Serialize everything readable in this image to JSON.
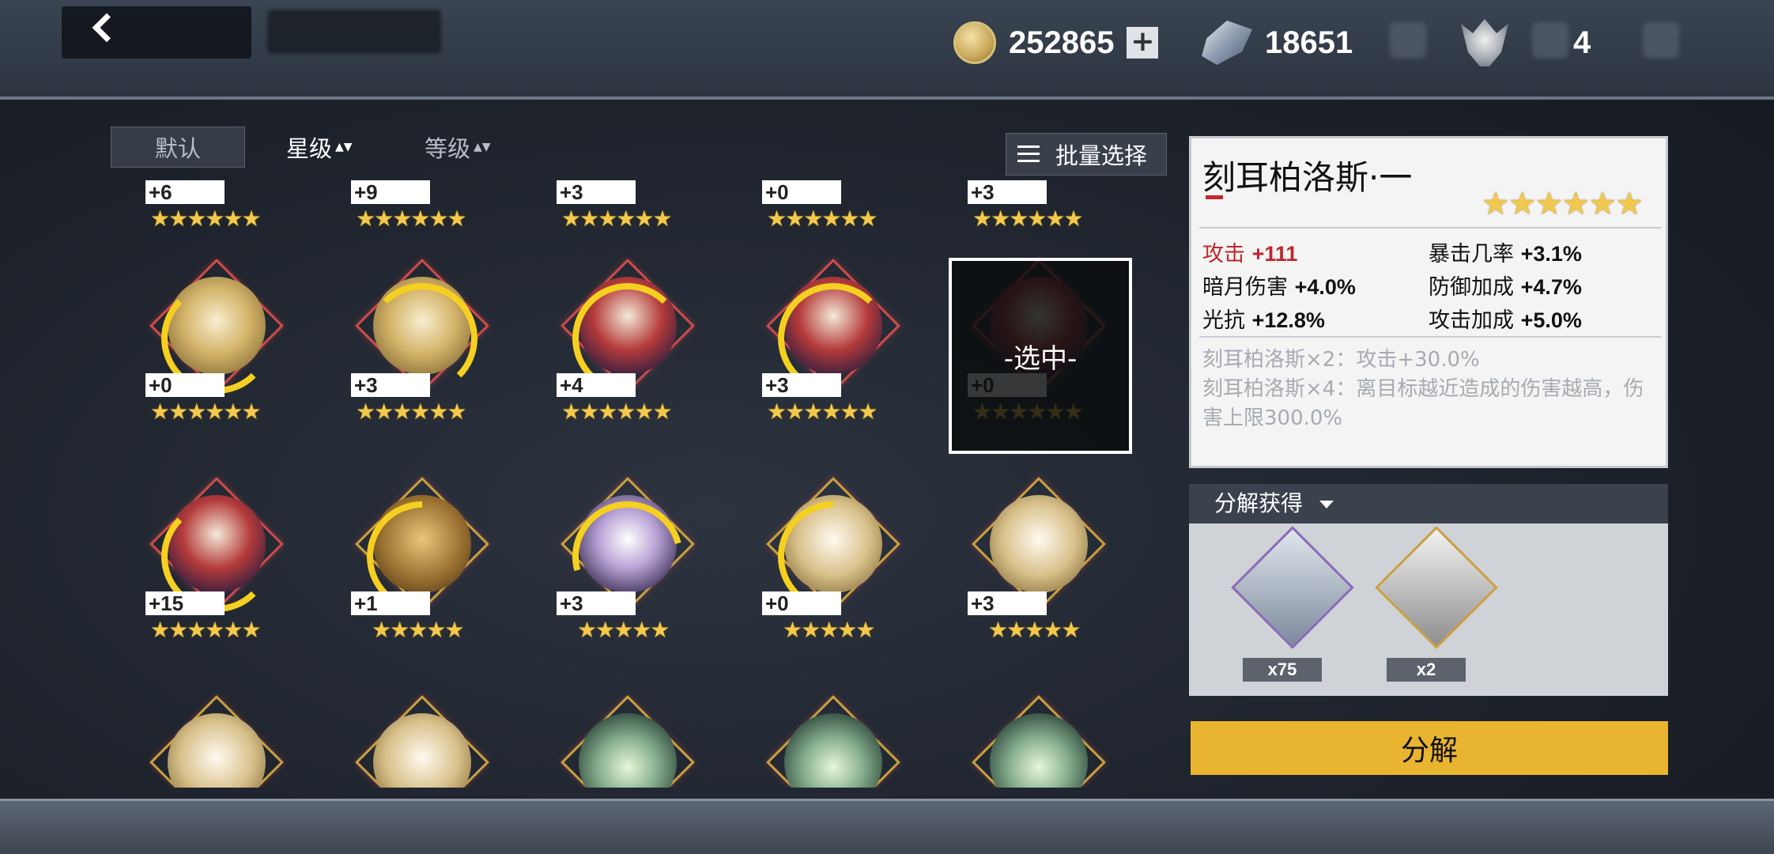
{
  "header": {
    "coins": "252865",
    "crystals": "18651",
    "skulls": "4",
    "add_symbol": "+"
  },
  "sort": {
    "default_label": "默认",
    "star_label": "星级",
    "level_label": "等级",
    "arrows": "▲▼",
    "batch_label": "批量选择"
  },
  "grid": {
    "row0": [
      {
        "plus": "+6",
        "stars": "★★★★★★"
      },
      {
        "plus": "+9",
        "stars": "★★★★★★"
      },
      {
        "plus": "+3",
        "stars": "★★★★★★"
      },
      {
        "plus": "+0",
        "stars": "★★★★★★"
      },
      {
        "plus": "+3",
        "stars": "★★★★★★"
      }
    ],
    "row1": [
      {
        "plus": "+0",
        "stars": "★★★★★★",
        "icon": "sphinx"
      },
      {
        "plus": "+3",
        "stars": "★★★★★★",
        "icon": "sphinx"
      },
      {
        "plus": "+4",
        "stars": "★★★★★★",
        "icon": "cerberus"
      },
      {
        "plus": "+3",
        "stars": "★★★★★★",
        "icon": "cerberus"
      },
      {
        "plus": "+0",
        "stars": "★★★★★★",
        "icon": "cerberus",
        "selected": true
      }
    ],
    "row2": [
      {
        "plus": "+15",
        "stars": "★★★★★★",
        "icon": "cerberus"
      },
      {
        "plus": "+1",
        "stars": "★★★★★",
        "icon": "lion"
      },
      {
        "plus": "+3",
        "stars": "★★★★★",
        "icon": "serpent"
      },
      {
        "plus": "+0",
        "stars": "★★★★★",
        "icon": "phoenix"
      },
      {
        "plus": "+3",
        "stars": "★★★★★",
        "icon": "phoenix"
      }
    ],
    "selected_label": "-选中-"
  },
  "detail": {
    "name": "刻耳柏洛斯·一",
    "stars": "★★★★★★",
    "stats": [
      {
        "label": "攻击",
        "value": "+111"
      },
      {
        "label": "暴击几率",
        "value": "+3.1%"
      },
      {
        "label": "暗月伤害",
        "value": "+4.0%"
      },
      {
        "label": "防御加成",
        "value": "+4.7%"
      },
      {
        "label": "光抗",
        "value": "+12.8%"
      },
      {
        "label": "攻击加成",
        "value": "+5.0%"
      }
    ],
    "set2": "刻耳柏洛斯×2：攻击+30.0%",
    "set4": "刻耳柏洛斯×4：离目标越近造成的伤害越高，伤害上限300.0%"
  },
  "decompose": {
    "header": "分解获得",
    "items": [
      {
        "icon": "dragon-crystal-icon",
        "count": "x75"
      },
      {
        "icon": "skull-token-icon",
        "count": "x2"
      }
    ],
    "button": "分解"
  },
  "colors": {
    "accent": "#e9b430",
    "star": "#f2c94c",
    "stat_red": "#c0262d",
    "selected_border": "#ffffff"
  }
}
